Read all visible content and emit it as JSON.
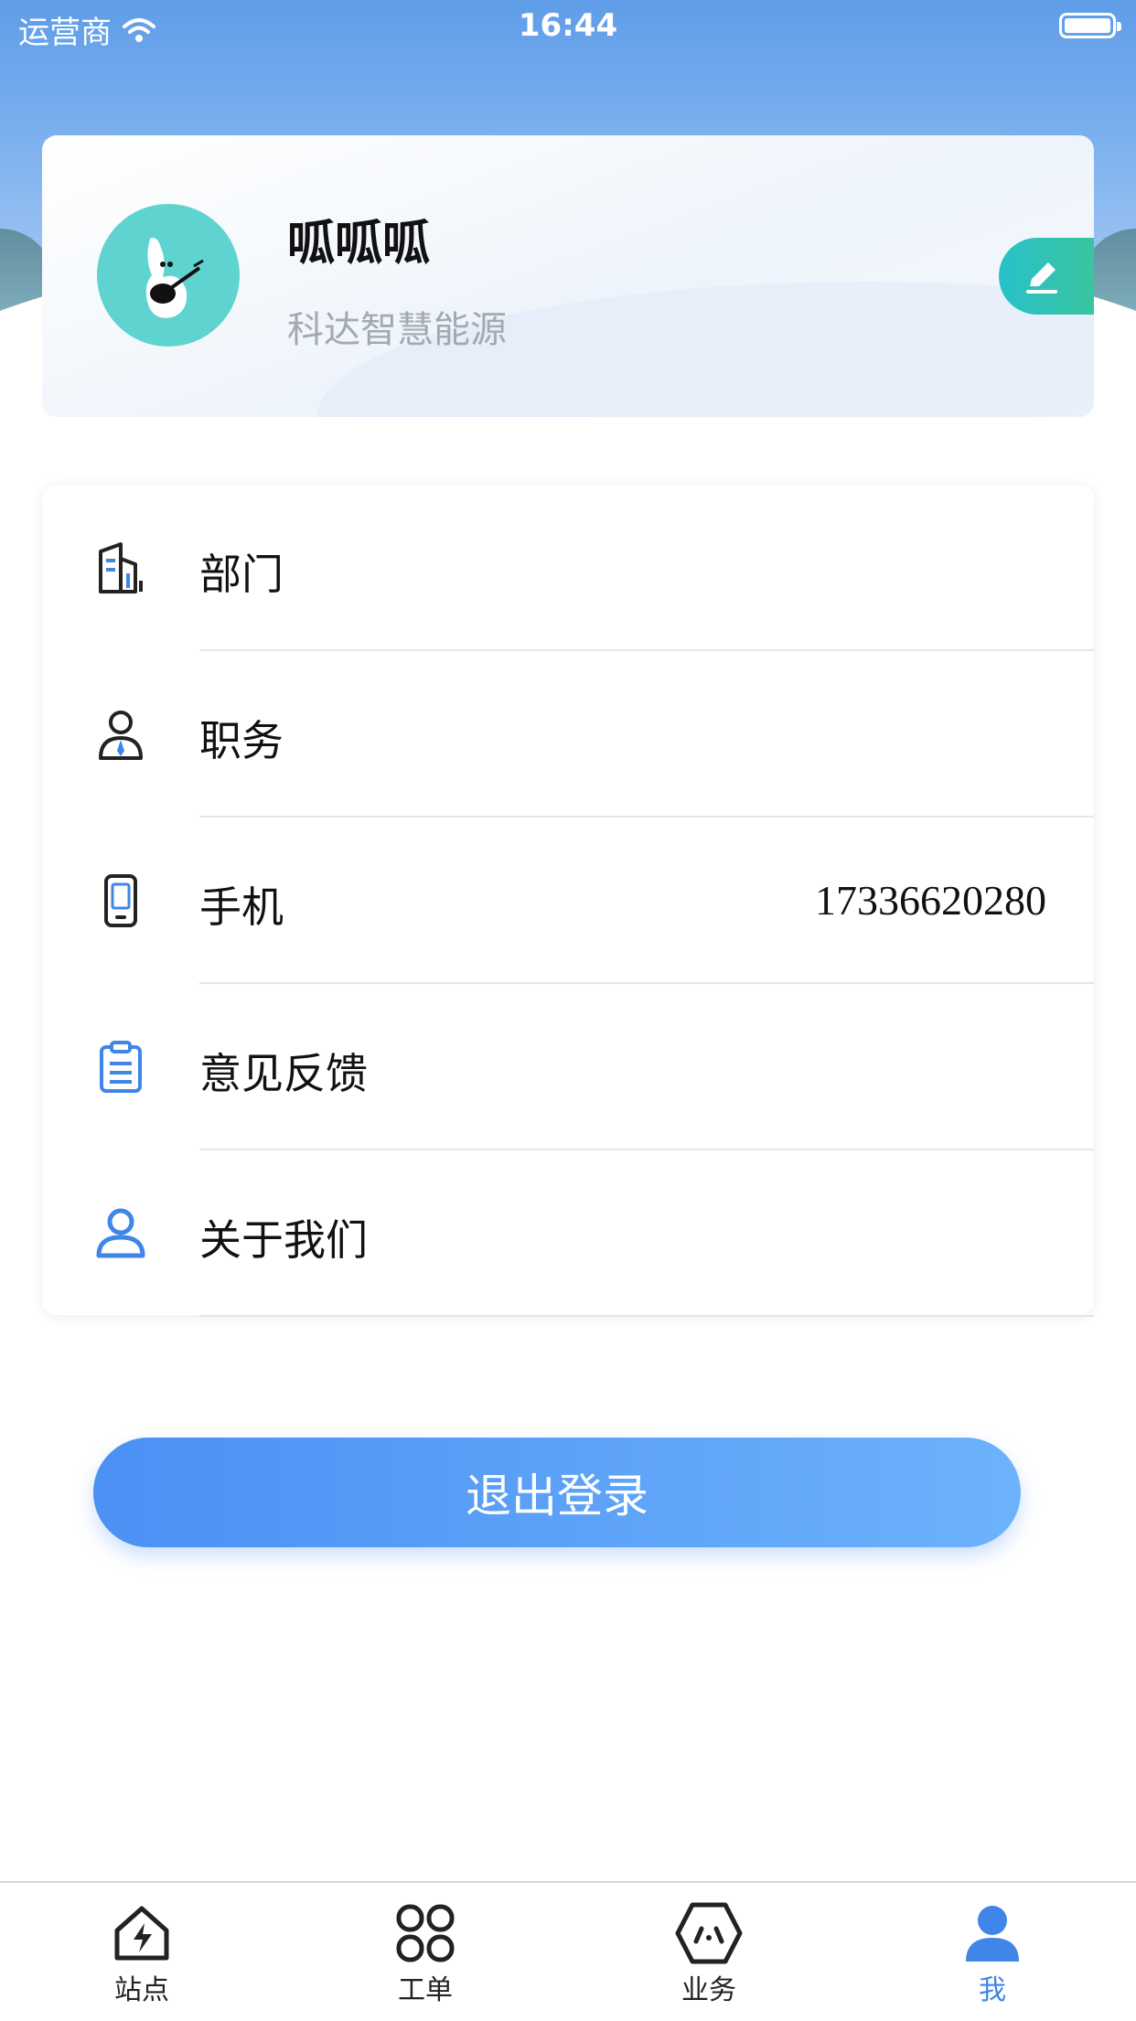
{
  "status_bar": {
    "carrier": "运营商",
    "time": "16:44"
  },
  "profile": {
    "name": "呱呱呱",
    "company": "科达智慧能源"
  },
  "menu": {
    "items": [
      {
        "label": "部门",
        "value": "",
        "icon": "building-icon"
      },
      {
        "label": "职务",
        "value": "",
        "icon": "person-tie-icon"
      },
      {
        "label": "手机",
        "value": "17336620280",
        "icon": "phone-icon"
      },
      {
        "label": "意见反馈",
        "value": "",
        "icon": "clipboard-icon"
      },
      {
        "label": "关于我们",
        "value": "",
        "icon": "user-icon"
      }
    ]
  },
  "logout": {
    "label": "退出登录"
  },
  "tabbar": {
    "tabs": [
      {
        "label": "站点",
        "icon": "station-icon"
      },
      {
        "label": "工单",
        "icon": "grid-icon"
      },
      {
        "label": "业务",
        "icon": "hexagon-icon"
      },
      {
        "label": "我",
        "icon": "profile-icon"
      }
    ],
    "active_index": 3
  },
  "colors": {
    "accent": "#3f86e8",
    "edit_button": "#2cc2b8",
    "avatar_bg": "#5fd3cf",
    "header_blue": "#5f9de8"
  }
}
